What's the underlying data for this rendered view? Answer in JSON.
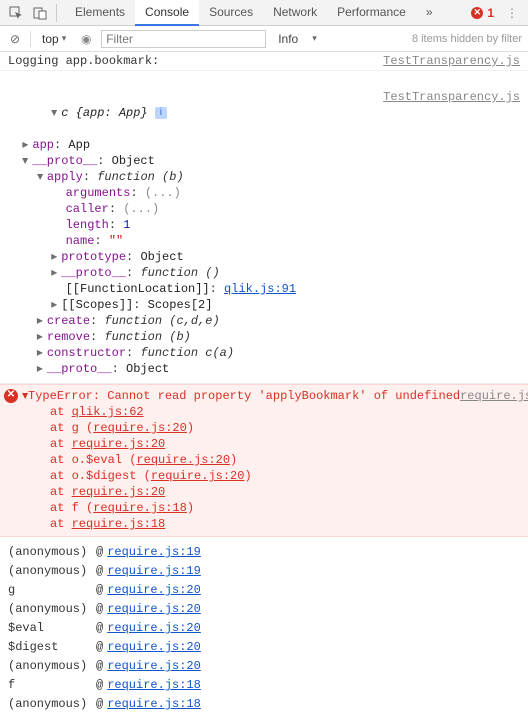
{
  "topbar": {
    "tabs": [
      "Elements",
      "Console",
      "Sources",
      "Network",
      "Performance"
    ],
    "active_tab": "Console",
    "overflow": "»",
    "error_count": "1"
  },
  "toolbar": {
    "clear_icon": "⊘",
    "context": "top",
    "context_arrow": "▾",
    "filter_placeholder": "Filter",
    "level": "Info",
    "level_arrow": "▾",
    "hidden_msg": "8 items hidden by filter"
  },
  "log1": {
    "msg": "Logging app.bookmark:",
    "src": "TestTransparency.js"
  },
  "tree": {
    "src": "TestTransparency.js",
    "root": "c {app: App}",
    "info_badge": "i",
    "app_key": "app",
    "app_val": "App",
    "proto_key": "__proto__",
    "proto_val": "Object",
    "apply_key": "apply",
    "apply_val": "function (b)",
    "arguments_key": "arguments",
    "arguments_val": "(...)",
    "caller_key": "caller",
    "caller_val": "(...)",
    "length_key": "length",
    "length_val": "1",
    "name_key": "name",
    "name_val": "\"\"",
    "prototype_key": "prototype",
    "prototype_val": "Object",
    "inner_proto_key": "__proto__",
    "inner_proto_val": "function ()",
    "funcloc_key": "[[FunctionLocation]]",
    "funcloc_val": "qlik.js:91",
    "scopes_key": "[[Scopes]]",
    "scopes_val": "Scopes[2]",
    "create_key": "create",
    "create_val": "function (c,d,e)",
    "remove_key": "remove",
    "remove_val": "function (b)",
    "constructor_key": "constructor",
    "constructor_val": "function c(a)",
    "outer_proto2_key": "__proto__",
    "outer_proto2_val": "Object"
  },
  "error": {
    "title": "TypeError: Cannot read property 'applyBookmark' of undefined",
    "src": "require.js",
    "lines": [
      {
        "pre": "at ",
        "link": "qlik.js:62",
        "post": ""
      },
      {
        "pre": "at g (",
        "link": "require.js:20",
        "post": ")"
      },
      {
        "pre": "at ",
        "link": "require.js:20",
        "post": ""
      },
      {
        "pre": "at o.$eval (",
        "link": "require.js:20",
        "post": ")"
      },
      {
        "pre": "at o.$digest (",
        "link": "require.js:20",
        "post": ")"
      },
      {
        "pre": "at ",
        "link": "require.js:20",
        "post": ""
      },
      {
        "pre": "at f (",
        "link": "require.js:18",
        "post": ")"
      },
      {
        "pre": "at ",
        "link": "require.js:18",
        "post": ""
      }
    ]
  },
  "stack": [
    {
      "fn": "(anonymous)",
      "loc": "require.js:19"
    },
    {
      "fn": "(anonymous)",
      "loc": "require.js:19"
    },
    {
      "fn": "g",
      "loc": "require.js:20"
    },
    {
      "fn": "(anonymous)",
      "loc": "require.js:20"
    },
    {
      "fn": "$eval",
      "loc": "require.js:20"
    },
    {
      "fn": "$digest",
      "loc": "require.js:20"
    },
    {
      "fn": "(anonymous)",
      "loc": "require.js:20"
    },
    {
      "fn": "f",
      "loc": "require.js:18"
    },
    {
      "fn": "(anonymous)",
      "loc": "require.js:18"
    }
  ]
}
